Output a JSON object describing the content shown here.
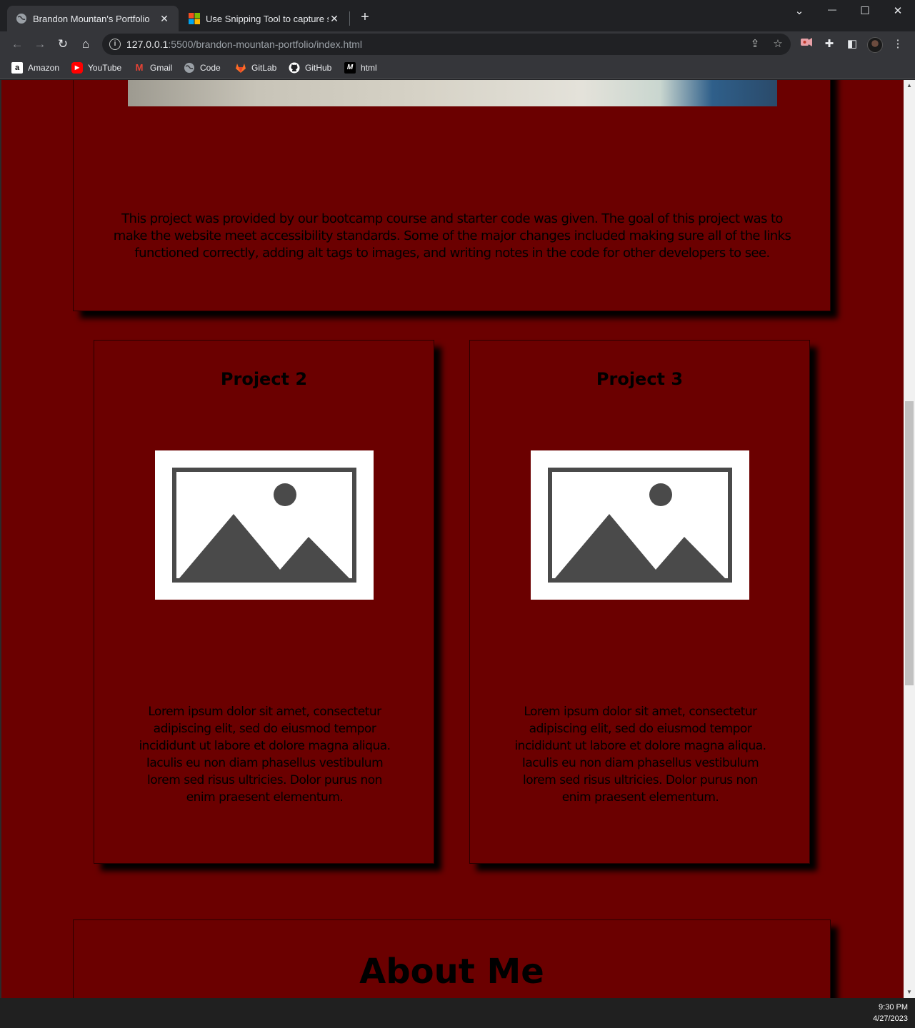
{
  "browser": {
    "tabs": [
      {
        "title": "Brandon Mountan's Portfolio",
        "active": true
      },
      {
        "title": "Use Snipping Tool to capture scre",
        "active": false
      }
    ],
    "new_tab": "+",
    "window_controls": {
      "dropdown": "⌄",
      "minimize": "—",
      "maximize": "☐",
      "close": "✕"
    },
    "url_host": "127.0.0.1",
    "url_rest": ":5500/brandon-mountan-portfolio/index.html",
    "bookmarks": [
      {
        "label": "Amazon",
        "icon": "amazon-icon"
      },
      {
        "label": "YouTube",
        "icon": "youtube-icon"
      },
      {
        "label": "Gmail",
        "icon": "gmail-icon"
      },
      {
        "label": "Code",
        "icon": "globe-icon"
      },
      {
        "label": "GitLab",
        "icon": "gitlab-icon"
      },
      {
        "label": "GitHub",
        "icon": "github-icon"
      },
      {
        "label": "html",
        "icon": "html-icon"
      }
    ]
  },
  "page": {
    "project1_description": "This project was provided by our bootcamp course and starter code was given. The goal of this project was to make the website meet accessibility standards. Some of the major changes included making sure all of the links functioned correctly, adding alt tags to images, and writing notes in the code for other developers to see.",
    "projects": [
      {
        "title": "Project 2",
        "description": "Lorem ipsum dolor sit amet, consectetur adipiscing elit, sed do eiusmod tempor incididunt ut labore et dolore magna aliqua. Iaculis eu non diam phasellus vestibulum lorem sed risus ultricies. Dolor purus non enim praesent elementum."
      },
      {
        "title": "Project 3",
        "description": "Lorem ipsum dolor sit amet, consectetur adipiscing elit, sed do eiusmod tempor incididunt ut labore et dolore magna aliqua. Iaculis eu non diam phasellus vestibulum lorem sed risus ultricies. Dolor purus non enim praesent elementum."
      }
    ],
    "about_title": "About Me",
    "colors": {
      "page_bg": "#6b0000",
      "text": "#000000",
      "placeholder_bg": "#ffffff",
      "placeholder_fg": "#4a4a4a"
    }
  },
  "taskbar": {
    "time": "9:30 PM",
    "date": "4/27/2023"
  }
}
